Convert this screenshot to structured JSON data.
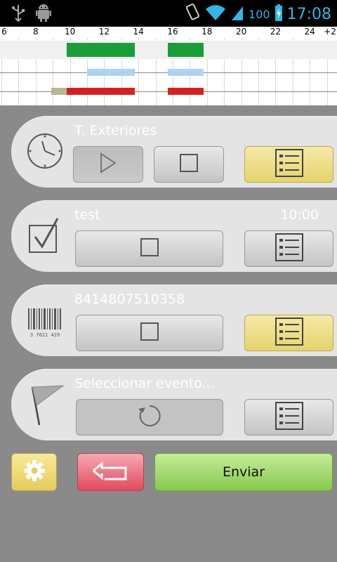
{
  "status_bar": {
    "battery": "100",
    "time": "17:08",
    "icons": [
      "usb-icon",
      "android-debug-icon",
      "vibrate-icon",
      "wifi-icon",
      "signal-icon",
      "battery-charging-icon"
    ]
  },
  "timeline": {
    "tick_labels": [
      "6",
      "8",
      "10",
      "12",
      "14",
      "16",
      "18",
      "20",
      "22",
      "24",
      "+2"
    ],
    "rows": [
      {
        "color": "#1a9e3a",
        "segments": [
          [
            9.8,
            13.8
          ],
          [
            15.7,
            17.8
          ]
        ]
      },
      {
        "color": "#aed3f3",
        "segments": [
          [
            11.0,
            13.8
          ],
          [
            15.7,
            17.8
          ]
        ]
      },
      {
        "color": "#d81f1f",
        "pre_segment_color": "#b7b697",
        "pre_segment": [
          8.9,
          9.8
        ],
        "segments": [
          [
            9.8,
            13.8
          ],
          [
            15.7,
            17.8
          ]
        ]
      }
    ]
  },
  "cards": [
    {
      "title": "T. Exteriores",
      "time": "",
      "icon": "clock-icon"
    },
    {
      "title": "test",
      "time": "10:00",
      "icon": "checkbox-icon"
    },
    {
      "title": "8414807510358",
      "time": "",
      "icon": "barcode-icon",
      "barcode_caption": "3 7621 419"
    },
    {
      "title": "Seleccionar evento...",
      "time": "",
      "icon": "flag-icon"
    }
  ],
  "bottom": {
    "send_label": "Enviar"
  },
  "colors": {
    "background": "#8a8a8a",
    "card": "#e4e4e4",
    "accent_yellow": "#e6d36c",
    "clock_blue": "#33b5e5"
  }
}
